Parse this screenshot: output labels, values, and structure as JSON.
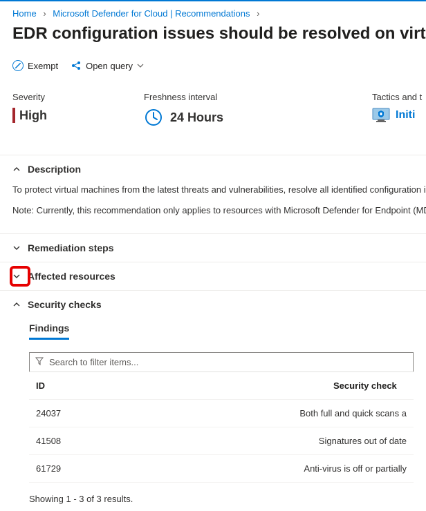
{
  "breadcrumbs": {
    "home": "Home",
    "defender": "Microsoft Defender for Cloud | Recommendations"
  },
  "page_title": "EDR configuration issues should be resolved on virtual m",
  "toolbar": {
    "exempt": "Exempt",
    "open_query": "Open query"
  },
  "metrics": {
    "severity_label": "Severity",
    "severity_value": "High",
    "freshness_label": "Freshness interval",
    "freshness_value": "24 Hours",
    "tactics_label": "Tactics and t",
    "tactics_value": "Initi"
  },
  "sections": {
    "description_title": "Description",
    "description_p1": "To protect virtual machines from the latest threats and vulnerabilities, resolve all identified configuration issue",
    "description_p2": "Note: Currently, this recommendation only applies to resources with Microsoft Defender for Endpoint (MDE) e",
    "remediation_title": "Remediation steps",
    "affected_title": "Affected resources",
    "security_title": "Security checks"
  },
  "findings": {
    "tab_label": "Findings",
    "search_placeholder": "Search to filter items...",
    "col_id": "ID",
    "col_check": "Security check",
    "rows": [
      {
        "id": "24037",
        "check": "Both full and quick scans a"
      },
      {
        "id": "41508",
        "check": "Signatures out of date"
      },
      {
        "id": "61729",
        "check": "Anti-virus is off or partially "
      }
    ],
    "results_text": "Showing 1 - 3 of 3 results."
  }
}
